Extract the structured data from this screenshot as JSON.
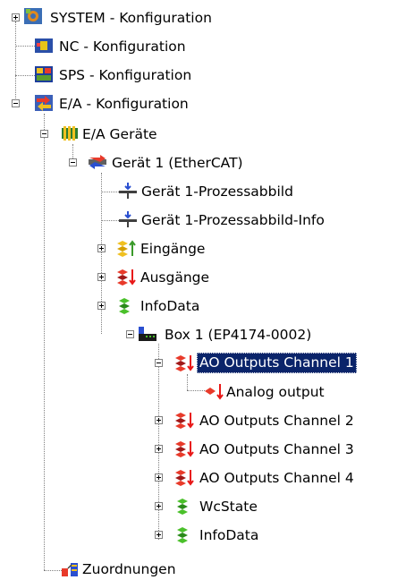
{
  "tree": {
    "system": "SYSTEM - Konfiguration",
    "nc": "NC - Konfiguration",
    "sps": "SPS - Konfiguration",
    "ea": "E/A - Konfiguration",
    "ea_geraete": "E/A Geräte",
    "geraet1": "Gerät 1 (EtherCAT)",
    "prozessabbild": "Gerät 1-Prozessabbild",
    "prozessabbild_info": "Gerät 1-Prozessabbild-Info",
    "eingaenge": "Eingänge",
    "ausgaenge": "Ausgänge",
    "infodata": "InfoData",
    "box1": "Box 1 (EP4174-0002)",
    "ao1": "AO Outputs Channel 1",
    "analog_output": "Analog output",
    "ao2": "AO Outputs Channel 2",
    "ao3": "AO Outputs Channel 3",
    "ao4": "AO Outputs Channel 4",
    "wcstate": "WcState",
    "box_infodata": "InfoData",
    "zuordnungen": "Zuordnungen"
  },
  "selected": "ao1",
  "colors": {
    "selection": "#0a246a",
    "tree_line": "#808080"
  }
}
